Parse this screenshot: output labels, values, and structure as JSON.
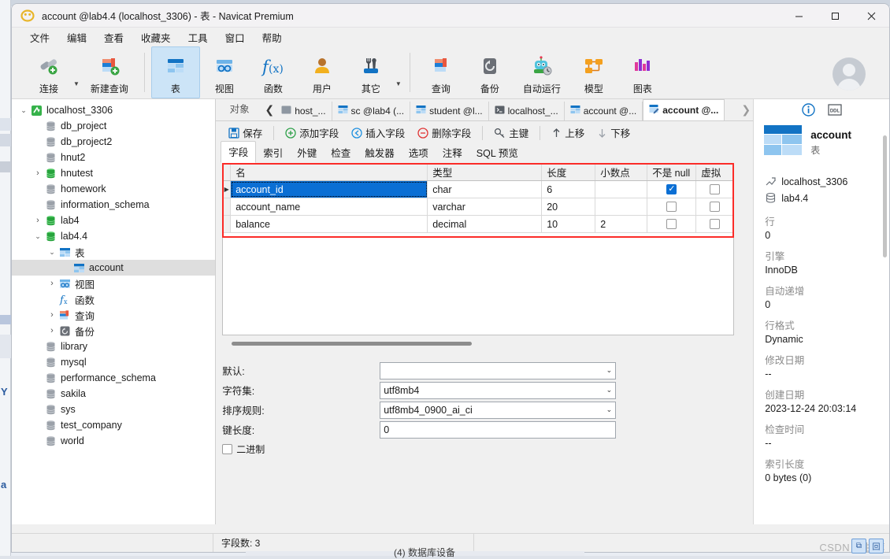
{
  "window": {
    "title": "account @lab4.4 (localhost_3306) - 表 - Navicat Premium",
    "minimize": "—",
    "maximize": "▢",
    "close": "✕"
  },
  "menubar": {
    "items": [
      {
        "label": "文件"
      },
      {
        "label": "编辑"
      },
      {
        "label": "查看"
      },
      {
        "label": "收藏夹"
      },
      {
        "label": "工具"
      },
      {
        "label": "窗口"
      },
      {
        "label": "帮助"
      }
    ]
  },
  "toolbar": {
    "items": [
      {
        "label": "连接",
        "icon": "connection-icon",
        "caret": true
      },
      {
        "label": "新建查询",
        "icon": "new-query-icon",
        "caret": false
      },
      {
        "label": "表",
        "icon": "table-icon",
        "active": true
      },
      {
        "label": "视图",
        "icon": "view-icon"
      },
      {
        "label": "函数",
        "icon": "function-icon"
      },
      {
        "label": "用户",
        "icon": "user-icon"
      },
      {
        "label": "其它",
        "icon": "other-tools-icon",
        "caret": true
      },
      {
        "label": "查询",
        "icon": "query-icon"
      },
      {
        "label": "备份",
        "icon": "backup-icon"
      },
      {
        "label": "自动运行",
        "icon": "automation-icon"
      },
      {
        "label": "模型",
        "icon": "model-icon"
      },
      {
        "label": "图表",
        "icon": "chart-icon"
      }
    ]
  },
  "sidebar": {
    "items": [
      {
        "label": "localhost_3306",
        "indent": 0,
        "twisty": "expanded",
        "icon": "connection-node-icon"
      },
      {
        "label": "db_project",
        "indent": 1,
        "twisty": "none",
        "icon": "database-gray-icon"
      },
      {
        "label": "db_project2",
        "indent": 1,
        "twisty": "none",
        "icon": "database-gray-icon"
      },
      {
        "label": "hnut2",
        "indent": 1,
        "twisty": "none",
        "icon": "database-gray-icon"
      },
      {
        "label": "hnutest",
        "indent": 1,
        "twisty": "collapsed",
        "icon": "database-green-icon"
      },
      {
        "label": "homework",
        "indent": 1,
        "twisty": "none",
        "icon": "database-gray-icon"
      },
      {
        "label": "information_schema",
        "indent": 1,
        "twisty": "none",
        "icon": "database-gray-icon"
      },
      {
        "label": "lab4",
        "indent": 1,
        "twisty": "collapsed",
        "icon": "database-green-icon"
      },
      {
        "label": "lab4.4",
        "indent": 1,
        "twisty": "expanded",
        "icon": "database-green-icon"
      },
      {
        "label": "表",
        "indent": 2,
        "twisty": "expanded",
        "icon": "table-folder-icon"
      },
      {
        "label": "account",
        "indent": 3,
        "twisty": "none",
        "icon": "table-icon",
        "selected": true
      },
      {
        "label": "视图",
        "indent": 2,
        "twisty": "collapsed",
        "icon": "view-folder-icon"
      },
      {
        "label": "函数",
        "indent": 2,
        "twisty": "none",
        "icon": "function-folder-icon"
      },
      {
        "label": "查询",
        "indent": 2,
        "twisty": "collapsed",
        "icon": "query-folder-icon"
      },
      {
        "label": "备份",
        "indent": 2,
        "twisty": "collapsed",
        "icon": "backup-folder-icon"
      },
      {
        "label": "library",
        "indent": 1,
        "twisty": "none",
        "icon": "database-gray-icon"
      },
      {
        "label": "mysql",
        "indent": 1,
        "twisty": "none",
        "icon": "database-gray-icon"
      },
      {
        "label": "performance_schema",
        "indent": 1,
        "twisty": "none",
        "icon": "database-gray-icon"
      },
      {
        "label": "sakila",
        "indent": 1,
        "twisty": "none",
        "icon": "database-gray-icon"
      },
      {
        "label": "sys",
        "indent": 1,
        "twisty": "none",
        "icon": "database-gray-icon"
      },
      {
        "label": "test_company",
        "indent": 1,
        "twisty": "none",
        "icon": "database-gray-icon"
      },
      {
        "label": "world",
        "indent": 1,
        "twisty": "none",
        "icon": "database-gray-icon"
      }
    ]
  },
  "tabstrip": {
    "object_label": "对象",
    "scroll_left": "❮",
    "scroll_right": "❯",
    "tabs": [
      {
        "label": "host_...",
        "icon": "connection-tab-icon",
        "active": false
      },
      {
        "label": "sc @lab4 (...",
        "icon": "table-tab-icon",
        "active": false
      },
      {
        "label": "student @l...",
        "icon": "table-tab-icon",
        "active": false
      },
      {
        "label": "localhost_...",
        "icon": "console-tab-icon",
        "active": false
      },
      {
        "label": "account @...",
        "icon": "table-tab-icon",
        "active": false
      },
      {
        "label": "account @...",
        "icon": "table-design-tab-icon",
        "active": true
      }
    ]
  },
  "editor_toolbar": {
    "buttons": [
      {
        "label": "保存",
        "icon": "save-icon"
      },
      {
        "label": "添加字段",
        "icon": "add-field-icon"
      },
      {
        "label": "插入字段",
        "icon": "insert-field-icon"
      },
      {
        "label": "删除字段",
        "icon": "delete-field-icon"
      },
      {
        "label": "主键",
        "icon": "primary-key-icon"
      },
      {
        "label": "上移",
        "icon": "move-up-icon"
      },
      {
        "label": "下移",
        "icon": "move-down-icon"
      }
    ]
  },
  "inner_tabs": {
    "items": [
      {
        "label": "字段",
        "active": true
      },
      {
        "label": "索引",
        "active": false
      },
      {
        "label": "外键",
        "active": false
      },
      {
        "label": "检查",
        "active": false
      },
      {
        "label": "触发器",
        "active": false
      },
      {
        "label": "选项",
        "active": false
      },
      {
        "label": "注释",
        "active": false
      },
      {
        "label": "SQL 预览",
        "active": false
      }
    ]
  },
  "grid": {
    "columns": [
      "名",
      "类型",
      "长度",
      "小数点",
      "不是 null",
      "虚拟"
    ],
    "rows": [
      {
        "name": "account_id",
        "type": "char",
        "length": "6",
        "decimals": "",
        "not_null": true,
        "virtual": false,
        "selected": true
      },
      {
        "name": "account_name",
        "type": "varchar",
        "length": "20",
        "decimals": "",
        "not_null": false,
        "virtual": false,
        "selected": false
      },
      {
        "name": "balance",
        "type": "decimal",
        "length": "10",
        "decimals": "2",
        "not_null": false,
        "virtual": false,
        "selected": false
      }
    ]
  },
  "properties": {
    "rows": [
      {
        "label": "默认:",
        "value": "",
        "control": "select"
      },
      {
        "label": "字符集:",
        "value": "utf8mb4",
        "control": "select"
      },
      {
        "label": "排序规则:",
        "value": "utf8mb4_0900_ai_ci",
        "control": "select"
      },
      {
        "label": "键长度:",
        "value": "0",
        "control": "text"
      }
    ],
    "binary_checkbox": {
      "label": "二进制",
      "checked": false
    }
  },
  "info_panel": {
    "info_icon": "ⓘ",
    "ddl_icon": "DDL",
    "title": "account",
    "subtitle": "表",
    "connection": "localhost_3306",
    "database": "lab4.4",
    "blocks": [
      {
        "label": "行",
        "value": "0"
      },
      {
        "label": "引擎",
        "value": "InnoDB"
      },
      {
        "label": "自动递增",
        "value": "0"
      },
      {
        "label": "行格式",
        "value": "Dynamic"
      },
      {
        "label": "修改日期",
        "value": "--"
      },
      {
        "label": "创建日期",
        "value": "2023-12-24 20:03:14"
      },
      {
        "label": "检查时间",
        "value": "--"
      },
      {
        "label": "索引长度",
        "value": "0 bytes (0)"
      }
    ]
  },
  "statusbar": {
    "field_count": "字段数: 3"
  },
  "watermark": {
    "text": "CSDN @甘醇"
  },
  "bottom_peek": {
    "text": "(4) 数据库设备"
  },
  "colors": {
    "accent_blue": "#0b6fd4",
    "highlight_red": "#fb2c28",
    "tab_active_bg": "#ffffff",
    "toolbar_active_bg": "#cce4f7"
  }
}
